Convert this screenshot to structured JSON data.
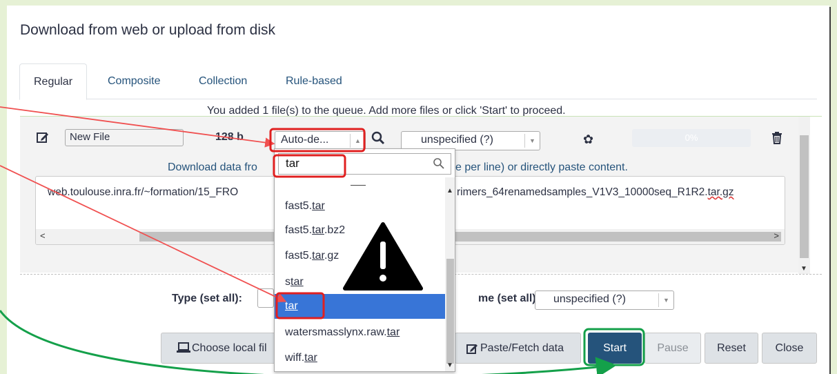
{
  "dialog": {
    "title": "Download from web or upload from disk"
  },
  "tabs": [
    {
      "label": "Regular",
      "active": true
    },
    {
      "label": "Composite",
      "active": false
    },
    {
      "label": "Collection",
      "active": false
    },
    {
      "label": "Rule-based",
      "active": false
    }
  ],
  "queue_message": "You added 1 file(s) to the queue. Add more files or click 'Start' to proceed.",
  "row": {
    "filename": "New File",
    "size": "128 b",
    "type_value": "Auto-de...",
    "genome_value": "unspecified (?)",
    "progress": "0%",
    "download_label_left": "Download data fro",
    "download_label_right": "e per line) or directly paste content.",
    "url_left": "web.toulouse.inra.fr/~formation/15_FRO",
    "url_right_plain": "rimers_64renamedsamples_V1V3_10000seq_R1R2.",
    "url_right_ext": "tar.gz"
  },
  "dropdown": {
    "search_value": "tar",
    "items": [
      {
        "pre": "fast5.",
        "match": "tar",
        "post": ""
      },
      {
        "pre": "fast5.",
        "match": "tar",
        "post": ".bz2"
      },
      {
        "pre": "fast5.",
        "match": "tar",
        "post": ".gz"
      },
      {
        "pre": "s",
        "match": "tar",
        "post": ""
      },
      {
        "pre": "",
        "match": "tar",
        "post": "",
        "highlighted": true
      },
      {
        "pre": "watersmasslynx.raw.",
        "match": "tar",
        "post": ""
      },
      {
        "pre": "wiff.",
        "match": "tar",
        "post": ""
      }
    ]
  },
  "set_all": {
    "type_label": "Type (set all):",
    "genome_label": "me (set all):",
    "genome_value": "unspecified (?)"
  },
  "buttons": {
    "choose_local": "Choose local fil",
    "paste_fetch": "Paste/Fetch data",
    "start": "Start",
    "pause": "Pause",
    "reset": "Reset",
    "close": "Close"
  },
  "colors": {
    "background": "#e6f1d5",
    "primary": "#25537b",
    "highlight": "#3875d7",
    "annotation_red": "#e02020",
    "annotation_arrow": "#f05050",
    "annotation_green": "#14a04a"
  },
  "icons": [
    "edit-icon",
    "search-icon",
    "gear-icon",
    "trash-icon",
    "warning-icon",
    "laptop-icon",
    "pencil-square-icon"
  ]
}
